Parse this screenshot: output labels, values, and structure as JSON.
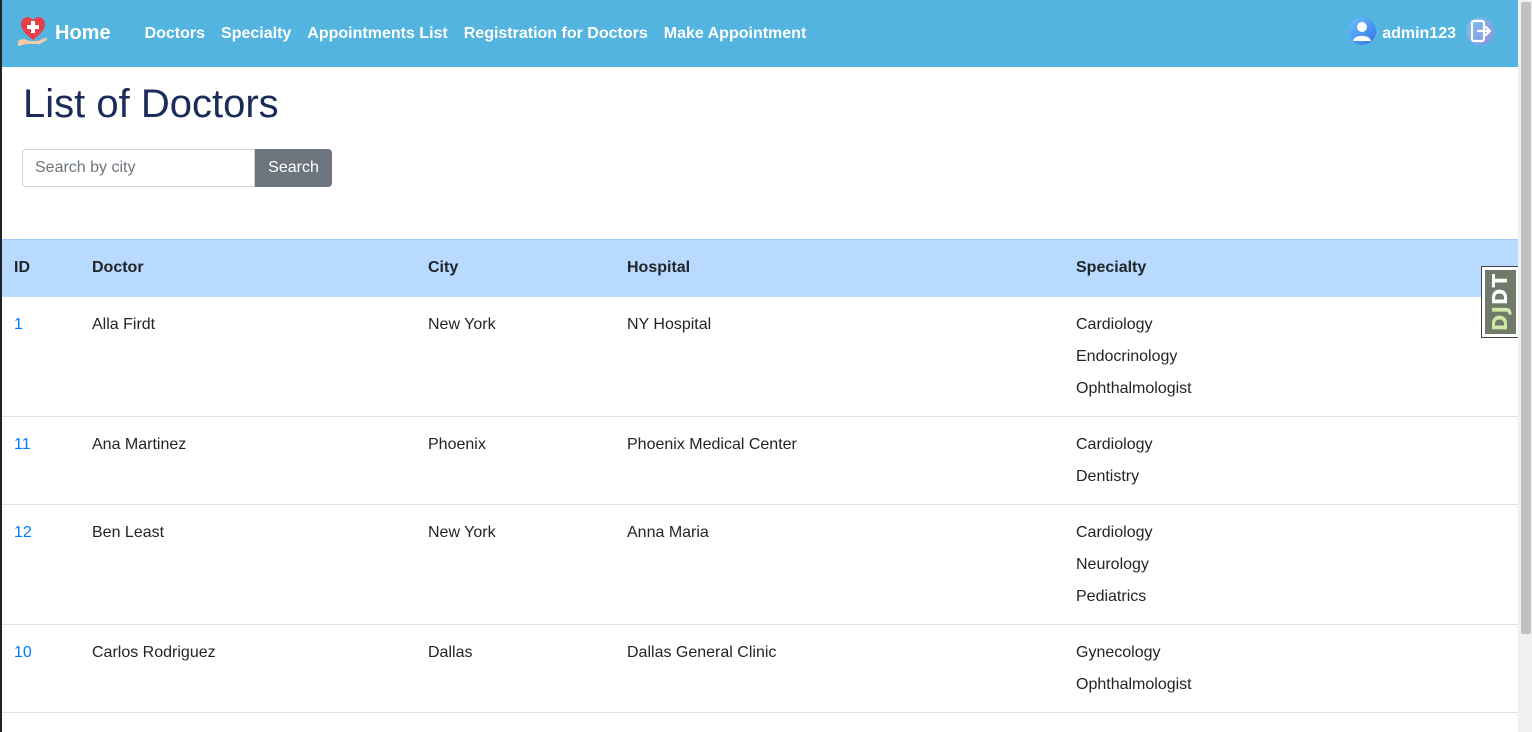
{
  "navbar": {
    "brand_label": "Home",
    "links": [
      "Doctors",
      "Specialty",
      "Appointments List",
      "Registration for Doctors",
      "Make Appointment"
    ],
    "username": "admin123",
    "bg_color": "#53b4e0"
  },
  "page": {
    "title": "List of Doctors"
  },
  "search": {
    "placeholder": "Search by city",
    "value": "",
    "button_label": "Search"
  },
  "table": {
    "headers": [
      "ID",
      "Doctor",
      "City",
      "Hospital",
      "Specialty"
    ],
    "rows": [
      {
        "id": "1",
        "doctor": "Alla Firdt",
        "city": "New York",
        "hospital": "NY Hospital",
        "specialties": [
          "Cardiology",
          "Endocrinology",
          "Ophthalmologist"
        ]
      },
      {
        "id": "11",
        "doctor": "Ana Martinez",
        "city": "Phoenix",
        "hospital": "Phoenix Medical Center",
        "specialties": [
          "Cardiology",
          "Dentistry"
        ]
      },
      {
        "id": "12",
        "doctor": "Ben Least",
        "city": "New York",
        "hospital": "Anna Maria",
        "specialties": [
          "Cardiology",
          "Neurology",
          "Pediatrics"
        ]
      },
      {
        "id": "10",
        "doctor": "Carlos Rodriguez",
        "city": "Dallas",
        "hospital": "Dallas General Clinic",
        "specialties": [
          "Gynecology",
          "Ophthalmologist"
        ]
      }
    ],
    "header_bg": "#b8daff",
    "link_color": "#007bff"
  },
  "debug_toolbar": {
    "label_dj": "DJ",
    "label_dt": "DT"
  }
}
